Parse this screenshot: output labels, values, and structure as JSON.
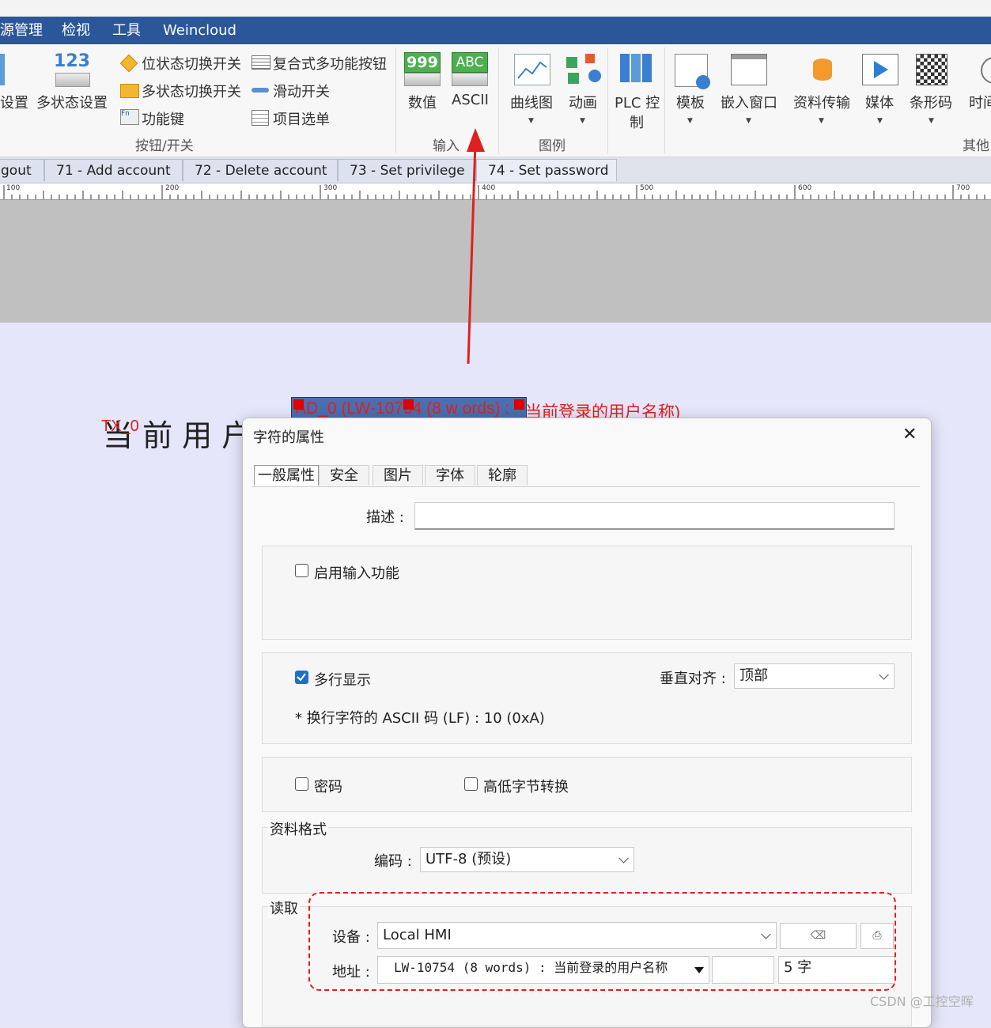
{
  "menubar": {
    "items": [
      "源管理",
      "检视",
      "工具",
      "Weincloud"
    ]
  },
  "ribbon": {
    "left_cut_label": "设置",
    "multistate_label": "多状态设置",
    "small_buttons": [
      "位状态切换开关",
      "多状态切换开关",
      "功能键",
      "复合式多功能按钮",
      "滑动开关",
      "项目选单"
    ],
    "group_buttons_label": "按钮/开关",
    "numeric_label": "数值",
    "ascii_label": "ASCII",
    "group_input_label": "输入",
    "numeric_icon_text": "999",
    "ascii_icon_text": "ABC",
    "multistate_icon_text": "123",
    "fn_icon_text": "Fn",
    "chart_label": "曲线图",
    "animation_label": "动画",
    "group_legend_label": "图例",
    "plc_label_1": "PLC 控",
    "plc_label_2": "制",
    "template_label": "模板",
    "embed_label": "嵌入窗口",
    "data_transfer_label": "资料传输",
    "media_label": "媒体",
    "barcode_label": "条形码",
    "time_label": "时间",
    "group_other_label": "其他"
  },
  "tabs": [
    "gout",
    "71 - Add account",
    "72 - Delete account",
    "73 - Set privilege",
    "74 - Set password"
  ],
  "ruler": {
    "ticks": [
      "100",
      "200",
      "300",
      "400",
      "500",
      "600",
      "700"
    ]
  },
  "canvas": {
    "current_user_text": "当 前 用 户",
    "tx_label": "TX_0",
    "ascii_object_label": "AD_0 (LW-10754 (8 w ords) :",
    "ascii_object_desc": "当前登录的用户名称)"
  },
  "dialog": {
    "title": "字符的属性",
    "close_glyph": "✕",
    "tabs": [
      "一般属性",
      "安全",
      "图片",
      "字体",
      "轮廓"
    ],
    "description_label": "描述 :",
    "description_value": "",
    "enable_input_label": "启用输入功能",
    "enable_input_checked": false,
    "multiline_label": "多行显示",
    "multiline_checked": true,
    "vertical_align_label": "垂直对齐 :",
    "vertical_align_value": "顶部",
    "lf_note": "* 换行字符的 ASCII 码 (LF) : 10 (0xA)",
    "password_label": "密码",
    "password_checked": false,
    "byte_swap_label": "高低字节转换",
    "byte_swap_checked": false,
    "data_format_legend": "资料格式",
    "encoding_label": "编码 :",
    "encoding_value": "UTF-8 (预设)",
    "read_legend": "读取",
    "device_label": "设备 :",
    "device_value": "Local HMI",
    "address_label": "地址 :",
    "address_value": "LW-10754 (8 words) : 当前登录的用户名称",
    "address_extra_value": "",
    "length_value": "5 字"
  },
  "watermark": "CSDN @工控空晖",
  "colors": {
    "menubar": "#2b579a",
    "annotation_red": "#e0201f",
    "checkbox_blue": "#1f6fc8"
  }
}
